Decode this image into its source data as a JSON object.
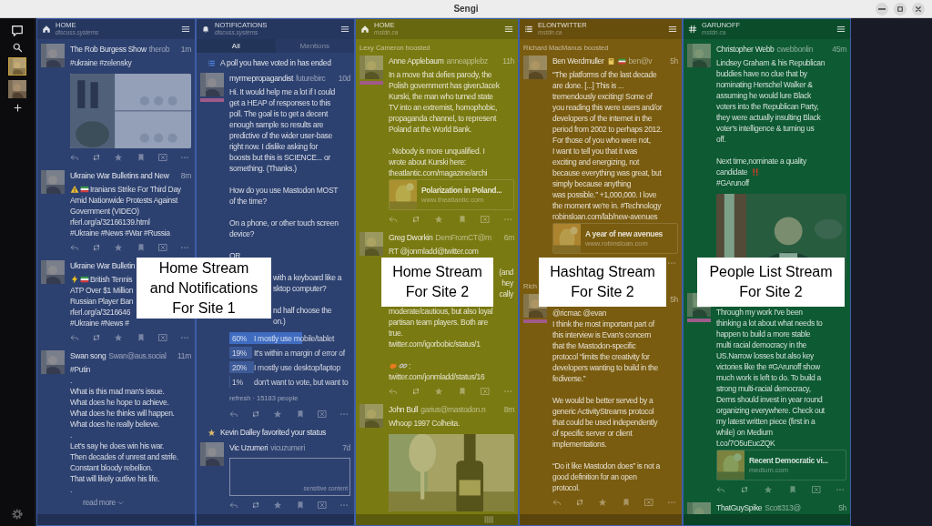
{
  "window": {
    "title": "Sengi"
  },
  "columns": [
    {
      "kind": "home",
      "title": "HOME",
      "subtitle": "discuss.systems",
      "color": "#2d4170",
      "items": [
        {
          "kind": "post",
          "author": "The Rob Burgess Show",
          "handle": "therob",
          "time": "1m",
          "paragraphs": [
            [
              "#ukraine #zelensky"
            ]
          ],
          "media": true,
          "actions": {
            "kind": "full"
          }
        },
        {
          "kind": "post",
          "author": "Ukraine War Bulletins and New",
          "time": "8m",
          "paragraphs": [
            [
              {
                "kind": "emoji_before",
                "emoji": [
                  {
                    "kind": "warning"
                  },
                  {
                    "kind": "flag"
                  }
                ],
                "text": "Iranians Strike For Third Day"
              },
              "Amid Nationwide Protests Against\nGovernment (VIDEO)\nrferl.org/a/32166139.html\n#Ukraine #News #War #Russia"
            ]
          ],
          "actions": {
            "kind": "full"
          }
        },
        {
          "kind": "post",
          "author": "Ukraine War Bulletin",
          "paragraphs": [
            [
              {
                "kind": "emoji_before",
                "emoji": [
                  {
                    "kind": "lightning"
                  },
                  {
                    "kind": "flag"
                  }
                ],
                "text": "British Tennis"
              },
              "ATP Over $1 Million\nRussian Player Ban\nrferl.org/a/3216646\n#Ukraine #News #"
            ]
          ],
          "actions": {
            "kind": "full"
          }
        },
        {
          "kind": "post",
          "author": "Swan song",
          "handle": "Swan@aus.social",
          "time": "11m",
          "paragraphs": [
            [
              "#Putin\n.\nWhat is this mad man's issue.\nWhat does he hope to achieve.\nWhat does he thinks will happen.\nWhat does he really believe.\n.\nLet's say he does win his war.\nThen decades of unrest and strife.\nConstant bloody rebellion.\nThat will likely outlive his life.\n."
            ]
          ],
          "read_more": "read more"
        }
      ]
    },
    {
      "kind": "notifications",
      "title": "NOTIFICATIONS",
      "subtitle": "discuss.systems",
      "color": "#2d4170",
      "tabs": [
        {
          "label": "All",
          "selected": true
        },
        {
          "label": "Mentions",
          "selected": false
        }
      ],
      "items": [
        {
          "kind": "poll_notice",
          "text": "A poll you have voted in has ended"
        },
        {
          "kind": "post",
          "author": "myrmepropagandist",
          "handle": "futurebirc",
          "time": "10d",
          "badge": true,
          "paragraphs": [
            [
              "Hi. It would help me a lot if I could\nget a HEAP of responses to this\npoll. The goal is to get a decent\nenough sample so results are\npredictive of the wider user-base\nright now. I dislike asking for\nboosts but this is SCIENCE... or\nsomething. (Thanks.)"
            ],
            [
              "How do you use Mastodon MOST\nof the time?"
            ],
            [
              "On a phone, or other touch screen\ndevice?"
            ],
            [
              "OR"
            ],
            [
              {
                "kind": "clipped_left",
                "text": "with a keyboard like a"
              },
              {
                "kind": "clipped_left",
                "text": "sktop computer?"
              }
            ],
            [
              {
                "kind": "clipped_left",
                "text": "nd half choose the"
              },
              {
                "kind": "clipped_left",
                "text": "on.)"
              }
            ]
          ],
          "poll": {
            "options": [
              {
                "percent": "60%",
                "text": "I mostly use mobile/tablet",
                "level": 0.6,
                "selected": true
              },
              {
                "percent": "19%",
                "text": "It's within a margin of error of",
                "level": 0.19,
                "selected": false
              },
              {
                "percent": "20%",
                "text": "I mostly use desktop/laptop",
                "level": 0.2,
                "selected": false
              },
              {
                "percent": "1%",
                "text": "don't want to vote, but want to",
                "level": 0.01,
                "selected": false
              }
            ],
            "footer": "refresh · 15183 people"
          },
          "actions": {
            "kind": "full"
          }
        },
        {
          "kind": "favorite_notice",
          "text": "Kevin Dalley favorited your status"
        },
        {
          "kind": "post",
          "author": "Vic Uzumeri",
          "handle": "vicuzumeri",
          "time": "7d",
          "sensitive": "sensitive content",
          "actions": {
            "kind": "full"
          }
        }
      ]
    },
    {
      "kind": "home",
      "title": "HOME",
      "subtitle": "mstdn.ca",
      "color": "#7a7a12",
      "footer_handle": true,
      "items": [
        {
          "kind": "post",
          "booster": "Lexy Cameron boosted",
          "author": "Anne Applebaum",
          "handle": "anneapplebz",
          "time": "11h",
          "badge": true,
          "paragraphs": [
            [
              "In a move that defies parody, the\nPolish government has givenJacek\nKurski, the man who turned state\nTV into an extremist, homophobic,\npropaganda channel, to represent\nPoland at the World Bank."
            ],
            [
              ". Nobody is more unqualified. I\nwrote about Kurski here:\ntheatlantic.com/magazine/archi"
            ]
          ],
          "card": {
            "title": "Polarization in Poland...",
            "domain": "www.theatlantic.com"
          },
          "actions": {
            "kind": "full"
          }
        },
        {
          "kind": "post",
          "author": "Greg Dworkin",
          "handle": "DemFromCT@m",
          "time": "6m",
          "paragraphs": [
            [
              "RT @jonmladd@twitter.com",
              {
                "kind": "clipped_right",
                "text": "(and"
              },
              {
                "kind": "clipped_right",
                "text": "hey"
              },
              {
                "kind": "clipped_right",
                "text": "cally"
              },
              "moderate/cautious, but also loyal\npartisan team players. Both are\ntrue.\ntwitter.com/igorbobic/status/1"
            ],
            [
              {
                "kind": "emoji_before",
                "emoji": [
                  {
                    "kind": "creature"
                  },
                  {
                    "kind": "link"
                  }
                ],
                "text": ":"
              },
              "twitter.com/jonmladd/status/16"
            ]
          ],
          "actions": {
            "kind": "full"
          }
        },
        {
          "kind": "post",
          "author": "John Bull",
          "handle": "garius@mastodon.n",
          "time": "8m",
          "paragraphs": [
            [
              "Whoop 1997 Colheita."
            ]
          ],
          "media": true
        }
      ]
    },
    {
      "kind": "list",
      "title": "ELONTWITTER",
      "subtitle": "mstdn.ca",
      "color": "#7a5c10",
      "items": [
        {
          "kind": "post",
          "booster": "Richard MacManus boosted",
          "author": "Ben Werdmuller",
          "name_emoji": [
            {
              "kind": "book"
            },
            {
              "kind": "flag"
            }
          ],
          "handle": "ben@v",
          "time": "5h",
          "paragraphs": [
            [
              "“The platforms of the last decade\nare done. [...] This is ...\ntremendously exciting! Some of\nyou reading this were users and/or\ndevelopers of the internet in the\nperiod from 2002 to perhaps 2012.\nFor those of you who were not,\nI want to tell you that it was\nexciting and energizing, not\nbecause everything was great, but\nsimply because anything\nwas possible.” +1,000,000. I love\nthe moment we're in. #Technology\nrobinsloan.com/lab/new-avenues"
            ]
          ],
          "card": {
            "title": "A year of new avenues",
            "domain": "www.robinsloan.com"
          },
          "actions": {
            "kind": "more_only"
          }
        },
        {
          "kind": "post",
          "booster": "Rich",
          "time": "5h",
          "badge": true,
          "paragraphs": [
            [
              "@ricmac @evan\nI think the most important part of\nthis interview is Evan's concern\nthat the Mastodon-specific\nprotocol “limits the creativity for\ndevelopers wanting to build in the\nfediverse.”"
            ],
            [
              "We would be better served by a\ngeneric ActivityStreams protocol\nthat could be used independently\nof specific server or client\nimplementations."
            ],
            [
              "“Do it like Mastodon does” is not a\ngood definition for an open\nprotocol."
            ]
          ],
          "actions": {
            "kind": "full"
          }
        }
      ]
    },
    {
      "kind": "hashtag",
      "title": "GARUNOFF",
      "subtitle": "mstdn.ca",
      "color": "#0e5a33",
      "items": [
        {
          "kind": "post",
          "author": "Christopher Webb",
          "handle": "cwebbonlin",
          "time": "45m",
          "paragraphs": [
            [
              "Lindsey Graham & his Republican\nbuddies have no clue that by\nnominating Herschel Walker &\nassuming he would lure Black\nvoters into the Republican Party,\nthey were actually insulting Black\nvoter's intelligence & turning us\noff."
            ],
            [
              "Next time,nominate a quality",
              {
                "kind": "emoji_after",
                "emoji": [
                  {
                    "kind": "exclaim"
                  }
                ],
                "text": "candidate"
              },
              "#GArunoff"
            ]
          ],
          "media": true
        },
        {
          "kind": "post",
          "badge": true,
          "paragraphs": [
            [
              "Through my work I've been\nthinking a lot about what needs to\nhappen to build a more stable\nmulti racial democracy in the\nUS.Narrow losses but also key\nvictories like the #GArunoff show\nmuch work is left to do. To build a\nstrong multi-racial democracy,\nDems should invest in year round\norganizing everywhere. Check out\nmy latest written piece (first in a\nwhile) on Medium\nt.co/7O5uEucZQK"
            ]
          ],
          "card": {
            "title": "Recent Democratic vi...",
            "domain": "medium.com"
          },
          "actions": {
            "kind": "full"
          }
        },
        {
          "kind": "post",
          "author": "ThatGuySpike",
          "handle": "Scott313@",
          "time": "5h"
        }
      ]
    }
  ],
  "overlays": [
    {
      "lines": [
        "Home Stream",
        "and Notifications",
        "For Site 1"
      ]
    },
    {
      "lines": [
        "Home Stream",
        "For Site 2"
      ]
    },
    {
      "lines": [
        "Hashtag Stream",
        "For Site 2"
      ]
    },
    {
      "lines": [
        "People List Stream",
        "For Site 2"
      ]
    }
  ]
}
